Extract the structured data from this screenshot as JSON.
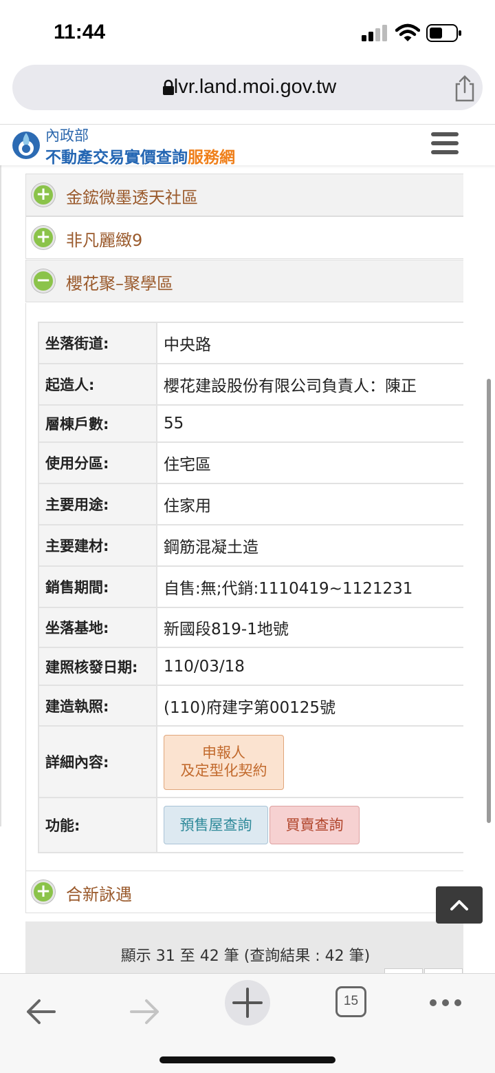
{
  "status_bar": {
    "time": "11:44"
  },
  "browser": {
    "url": "lvr.land.moi.gov.tw",
    "tab_count": "15"
  },
  "site": {
    "ministry": "內政部",
    "title_main": "不動產交易實價查詢",
    "title_accent": "服務網"
  },
  "accordion": {
    "items": [
      {
        "label": "金鋐微墨透天社區",
        "state": "+"
      },
      {
        "label": "非凡麗緻9",
        "state": "+"
      },
      {
        "label": "櫻花聚–聚學區",
        "state": "−"
      }
    ],
    "next_item": {
      "label": "合新詠遇",
      "state": "+"
    }
  },
  "detail": {
    "rows": [
      {
        "key": "坐落街道:",
        "value": "中央路"
      },
      {
        "key": "起造人:",
        "value": "櫻花建設股份有限公司負責人：陳正"
      },
      {
        "key": "層棟戶數:",
        "value": "55"
      },
      {
        "key": "使用分區:",
        "value": "住宅區"
      },
      {
        "key": "主要用途:",
        "value": "住家用"
      },
      {
        "key": "主要建材:",
        "value": "鋼筋混凝土造"
      },
      {
        "key": "銷售期間:",
        "value": "自售:無;代銷:1110419~1121231"
      },
      {
        "key": "坐落基地:",
        "value": "新國段819-1地號"
      },
      {
        "key": "建照核發日期:",
        "value": "110/03/18"
      },
      {
        "key": "建造執照:",
        "value": "(110)府建字第00125號"
      }
    ],
    "detail_key": "詳細內容:",
    "report_button_line1": "申報人",
    "report_button_line2": "及定型化契約",
    "function_key": "功能:",
    "presale_button": "預售屋查詢",
    "trade_button": "買賣查詢"
  },
  "pager": {
    "summary": "顯示 31 至 42 筆 (查詢結果 : 42 筆)"
  }
}
